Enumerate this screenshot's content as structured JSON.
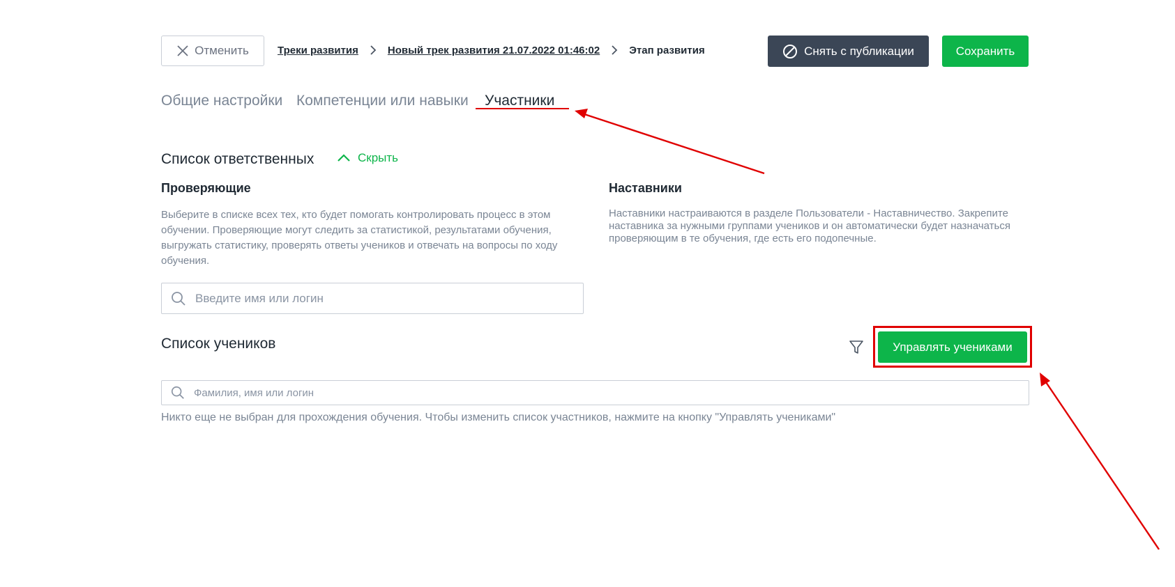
{
  "header": {
    "cancel_label": "Отменить",
    "breadcrumbs": [
      {
        "label": "Треки развития",
        "link": true
      },
      {
        "label": "Новый трек развития 21.07.2022 01:46:02",
        "link": true
      },
      {
        "label": "Этап развития",
        "link": false
      }
    ],
    "unpublish_label": "Снять с публикации",
    "save_label": "Сохранить"
  },
  "tabs": [
    {
      "label": "Общие настройки",
      "active": false
    },
    {
      "label": "Компетенции или навыки",
      "active": false
    },
    {
      "label": "Участники",
      "active": true
    }
  ],
  "responsibles": {
    "title": "Список ответственных",
    "toggle_label": "Скрыть",
    "reviewers": {
      "title": "Проверяющие",
      "description": "Выберите в списке всех тех, кто будет помогать контролировать процесс в этом обучении. Проверяющие могут следить за статистикой, результатами обучения, выгружать статистику, проверять ответы учеников и отвечать на вопросы по ходу обучения.",
      "search_placeholder": "Введите имя или логин"
    },
    "mentors": {
      "title": "Наставники",
      "description": "Наставники настраиваются в разделе Пользователи - Наставничество. Закрепите наставника за нужными группами учеников и он автоматически будет назначаться проверяющим в те обучения, где есть его подопечные."
    }
  },
  "students": {
    "title": "Список учеников",
    "manage_label": "Управлять учениками",
    "search_placeholder": "Фамилия, имя или логин",
    "empty_note": "Никто еще не выбран для прохождения обучения. Чтобы изменить список участников, нажмите на кнопку \"Управлять учениками\""
  },
  "colors": {
    "accent_green": "#0db54a",
    "dark_button": "#3b4656",
    "annotation_red": "#e00000",
    "muted_text": "#7a8594"
  },
  "icons": {
    "cancel": "close-icon",
    "breadcrumb_sep": "chevron-right-icon",
    "unpublish": "prohibit-icon",
    "toggle": "chevron-up-icon",
    "search": "search-icon",
    "filter": "filter-icon"
  }
}
